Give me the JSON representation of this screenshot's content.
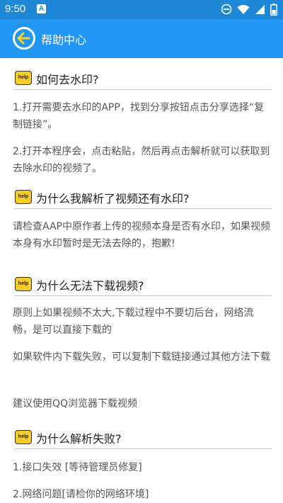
{
  "status_bar": {
    "time": "9:50",
    "notification_letter": "A"
  },
  "app_bar": {
    "title": "帮助中心"
  },
  "help_badge": "help",
  "sections": [
    {
      "question": "如何去水印?",
      "answers": [
        "1.打开需要去水印的APP，找到分享按钮点击分享选择“复制链接”。",
        "2.打开本程序会，点击粘贴，然后再点击解析就可以获取到去除水印的视频了。"
      ]
    },
    {
      "question": "为什么我解析了视频还有水印?",
      "answers": [
        "请检查AAP中原作者上传的视频本身是否有水印，如果视频本身有水印暂时是无法去除的，抱歉!"
      ]
    },
    {
      "question": "为什么无法下载视频?",
      "answers": [
        "原则上如果视频不太大,下载过程中不要切后台，网络流畅，是可以直接下载的",
        "如果软件内下载失败，可以复制下载链接通过其他方法下载",
        "建议使用QQ浏览器下载视频"
      ]
    },
    {
      "question": "为什么解析失败?",
      "answers": [
        "1.接口失效 [等待管理员修复]",
        "2.网络问题[请检你的网络环境]"
      ]
    }
  ]
}
